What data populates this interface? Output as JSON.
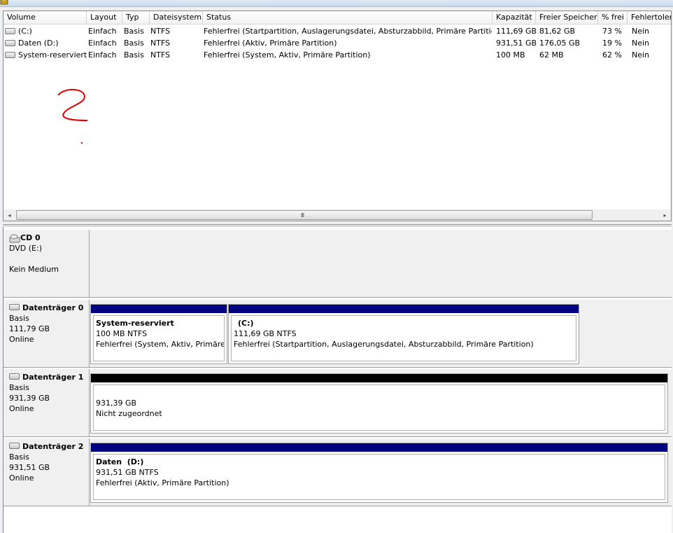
{
  "columns": [
    "Volume",
    "Layout",
    "Typ",
    "Dateisystem",
    "Status",
    "Kapazität",
    "Freier Speicher",
    "% frei",
    "Fehlertoleranz"
  ],
  "volumes": [
    {
      "name": "(C:)",
      "layout": "Einfach",
      "typ": "Basis",
      "fs": "NTFS",
      "status": "Fehlerfrei (Startpartition, Auslagerungsdatei, Absturzabbild, Primäre Partition)",
      "kapazitaet": "111,69 GB",
      "frei": "81,62 GB",
      "prozent": "73 %",
      "fehlertoleranz": "Nein"
    },
    {
      "name": "Daten (D:)",
      "layout": "Einfach",
      "typ": "Basis",
      "fs": "NTFS",
      "status": "Fehlerfrei (Aktiv, Primäre Partition)",
      "kapazitaet": "931,51 GB",
      "frei": "176,05 GB",
      "prozent": "19 %",
      "fehlertoleranz": "Nein"
    },
    {
      "name": "System-reserviert",
      "layout": "Einfach",
      "typ": "Basis",
      "fs": "NTFS",
      "status": "Fehlerfrei (System, Aktiv, Primäre Partition)",
      "kapazitaet": "100 MB",
      "frei": "62 MB",
      "prozent": "62 %",
      "fehlertoleranz": "Nein"
    }
  ],
  "scroll": {
    "left": "◂",
    "right": "▸",
    "grip": "III"
  },
  "colors": {
    "primary_partition": "#000080",
    "unallocated": "#000000"
  },
  "disks": {
    "cd0": {
      "title": "CD 0",
      "line1": "DVD (E:)",
      "line2": "",
      "line3": "Kein Medium"
    },
    "d0": {
      "title": "Datenträger 0",
      "type": "Basis",
      "size": "111,79 GB",
      "state": "Online",
      "partitions": [
        {
          "name": "System-reserviert",
          "size": "100 MB NTFS",
          "status": "Fehlerfrei (System, Aktiv, Primäre Partition)"
        },
        {
          "name": "(C:)",
          "size": "111,69 GB NTFS",
          "status": "Fehlerfrei (Startpartition, Auslagerungsdatei, Absturzabbild, Primäre Partition)"
        }
      ]
    },
    "d1": {
      "title": "Datenträger 1",
      "type": "Basis",
      "size": "931,39 GB",
      "state": "Online",
      "unallocated": {
        "size": "931,39 GB",
        "label": "Nicht zugeordnet"
      }
    },
    "d2": {
      "title": "Datenträger 2",
      "type": "Basis",
      "size": "931,51 GB",
      "state": "Online",
      "partition": {
        "name": "Daten  (D:)",
        "size": "931,51 GB NTFS",
        "status": "Fehlerfrei (Aktiv, Primäre Partition)"
      }
    }
  }
}
